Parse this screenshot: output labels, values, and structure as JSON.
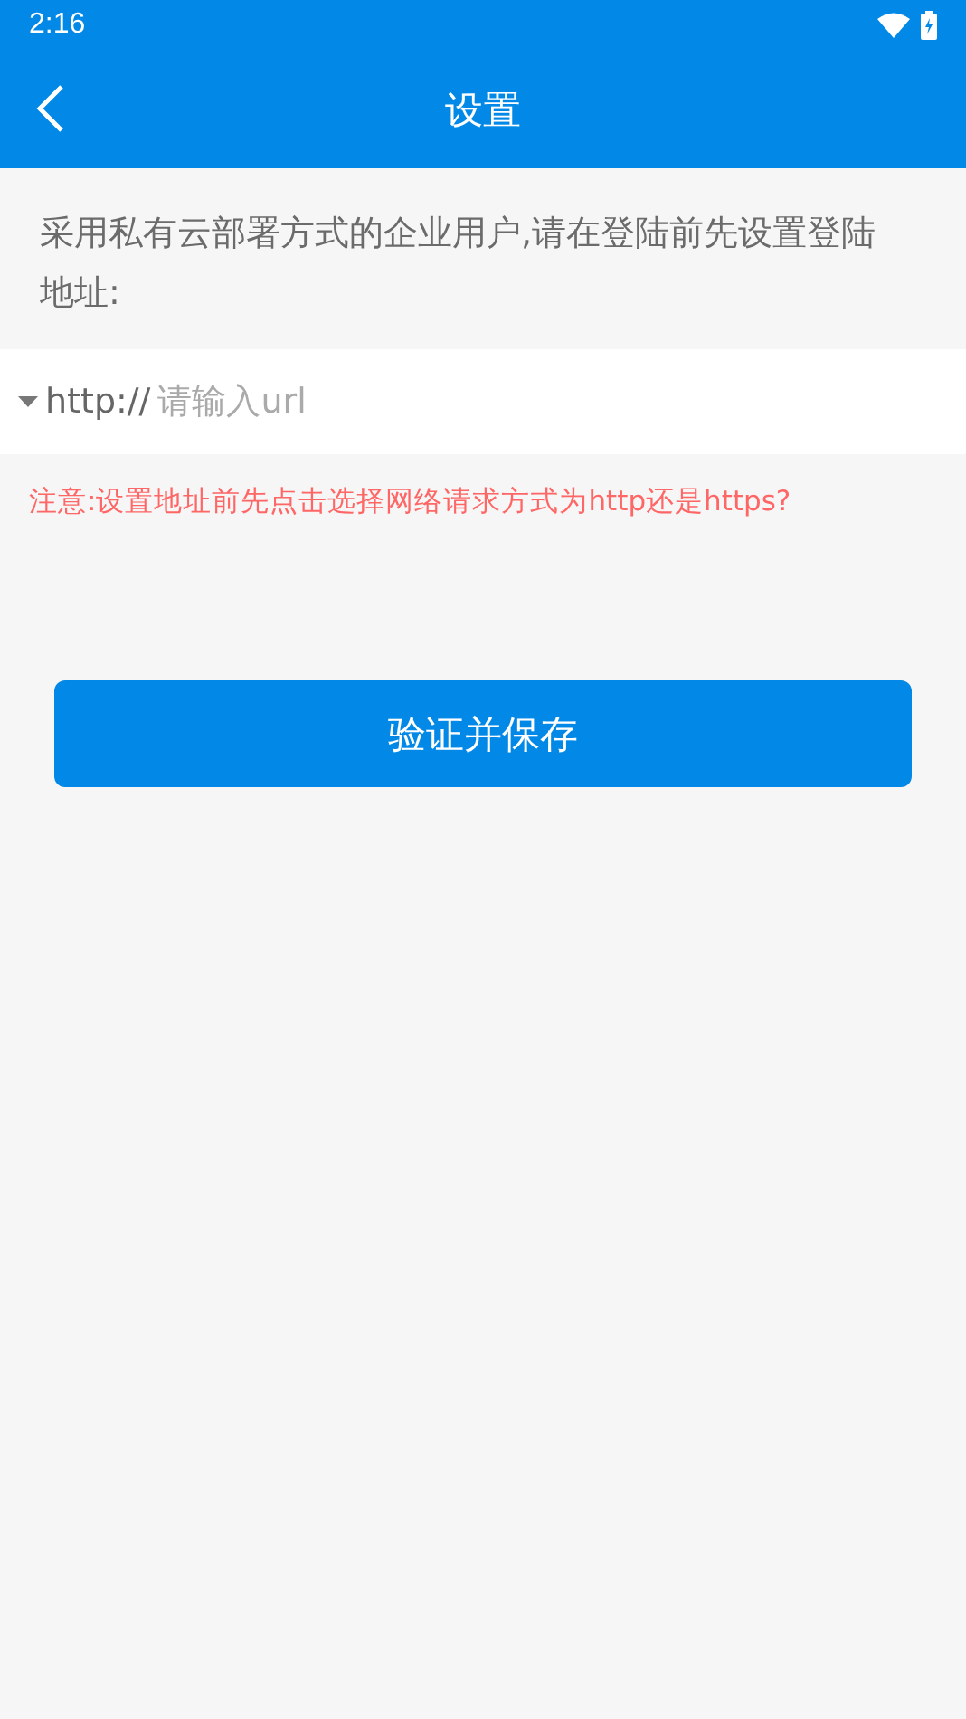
{
  "status_bar": {
    "time": "2:16"
  },
  "app_bar": {
    "title": "设置"
  },
  "intro": "采用私有云部署方式的企业用户,请在登陆前先设置登陆地址:",
  "url_field": {
    "protocol": "http://",
    "placeholder": "请输入url"
  },
  "note": "注意:设置地址前先点击选择网络请求方式为http还是https?",
  "save_button": "验证并保存"
}
